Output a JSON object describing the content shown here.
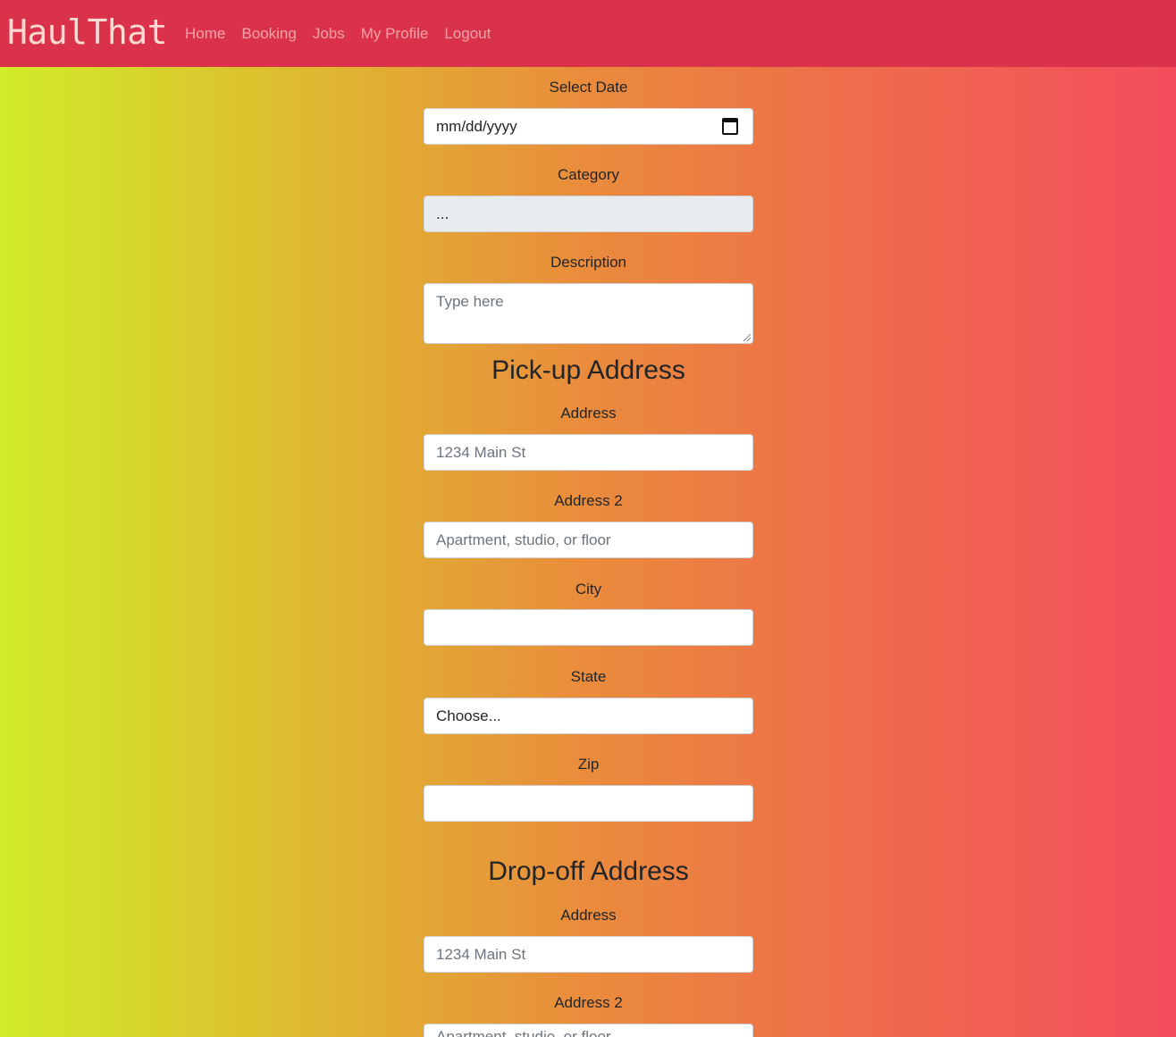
{
  "navbar": {
    "brand": "HaulThat",
    "links": [
      "Home",
      "Booking",
      "Jobs",
      "My Profile",
      "Logout"
    ]
  },
  "form": {
    "date": {
      "label": "Select Date",
      "placeholder": "mm/dd/yyyy"
    },
    "category": {
      "label": "Category",
      "value": "..."
    },
    "description": {
      "label": "Description",
      "placeholder": "Type here"
    },
    "pickup": {
      "title": "Pick-up Address",
      "address_label": "Address",
      "address_placeholder": "1234 Main St",
      "address2_label": "Address 2",
      "address2_placeholder": "Apartment, studio, or floor",
      "city_label": "City",
      "city_value": "",
      "state_label": "State",
      "state_value": "Choose...",
      "zip_label": "Zip",
      "zip_value": ""
    },
    "dropoff": {
      "title": "Drop-off Address",
      "address_label": "Address",
      "address_placeholder": "1234 Main St",
      "address2_label": "Address 2",
      "address2_placeholder": "Apartment, studio, or floor"
    }
  },
  "colors": {
    "navbar": "#db324b",
    "gradient_left": "#d1ec28",
    "gradient_right": "#f44d5d"
  }
}
